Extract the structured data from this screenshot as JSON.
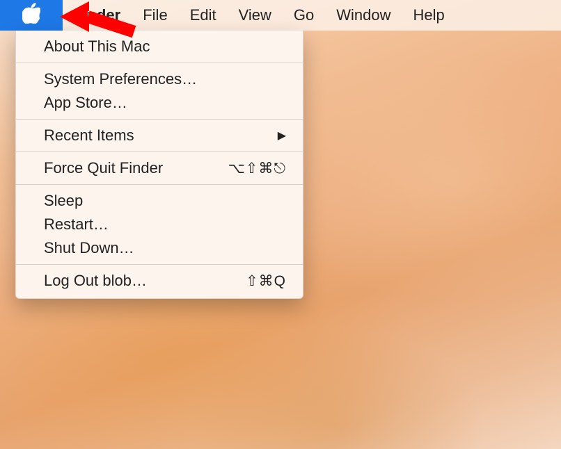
{
  "menubar": {
    "apple_icon": "apple-logo",
    "items": [
      {
        "label": "Finder",
        "bold": true
      },
      {
        "label": "File",
        "bold": false
      },
      {
        "label": "Edit",
        "bold": false
      },
      {
        "label": "View",
        "bold": false
      },
      {
        "label": "Go",
        "bold": false
      },
      {
        "label": "Window",
        "bold": false
      },
      {
        "label": "Help",
        "bold": false
      }
    ]
  },
  "apple_menu": {
    "groups": [
      [
        {
          "label": "About This Mac",
          "shortcut": "",
          "submenu": false
        }
      ],
      [
        {
          "label": "System Preferences…",
          "shortcut": "",
          "submenu": false
        },
        {
          "label": "App Store…",
          "shortcut": "",
          "submenu": false
        }
      ],
      [
        {
          "label": "Recent Items",
          "shortcut": "",
          "submenu": true
        }
      ],
      [
        {
          "label": "Force Quit Finder",
          "shortcut": "⌥⇧⌘⎋",
          "submenu": false
        }
      ],
      [
        {
          "label": "Sleep",
          "shortcut": "",
          "submenu": false
        },
        {
          "label": "Restart…",
          "shortcut": "",
          "submenu": false
        },
        {
          "label": "Shut Down…",
          "shortcut": "",
          "submenu": false
        }
      ],
      [
        {
          "label": "Log Out blob…",
          "shortcut": "⇧⌘Q",
          "submenu": false
        }
      ]
    ]
  },
  "annotation": {
    "arrow_color": "#ff0000",
    "points_to": "apple-menu-button"
  }
}
